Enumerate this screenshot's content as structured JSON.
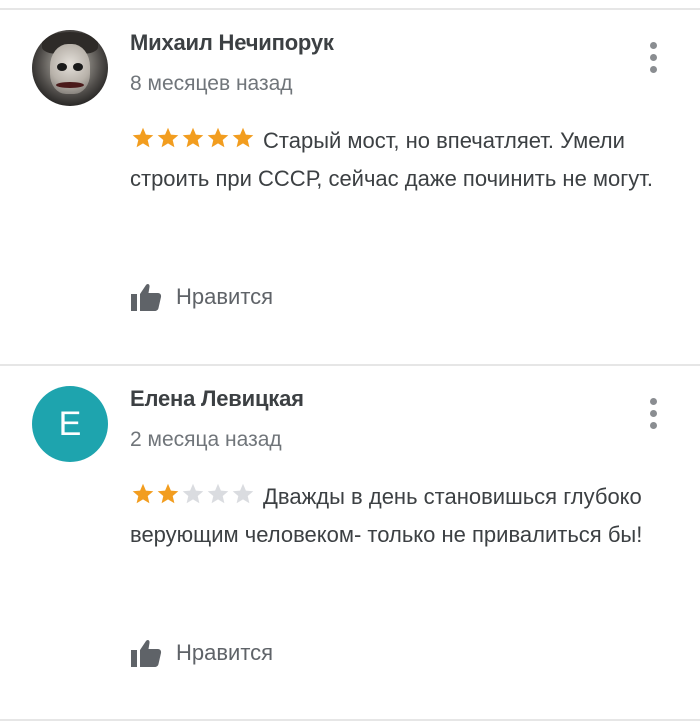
{
  "colors": {
    "star_filled": "#f29d1f",
    "star_empty": "#dadce0",
    "avatar_letter_bg": "#1ea4ae",
    "text": "#3c4043",
    "muted": "#70757a"
  },
  "reviews": [
    {
      "author": "Михаил Нечипорук",
      "date": "8 месяцев назад",
      "rating": 5,
      "max_rating": 5,
      "text": "Старый мост, но впечатляет. Умели строить при СССР, сейчас даже починить не могут.",
      "like_label": "Нравится",
      "avatar": {
        "type": "photo"
      },
      "menu_icon": "more-vert-icon"
    },
    {
      "author": "Елена Левицкая",
      "date": "2 месяца назад",
      "rating": 2,
      "max_rating": 5,
      "text": "Дважды в день становишься глубоко верующим человеком- только не привалиться бы!",
      "like_label": "Нравится",
      "avatar": {
        "type": "letter",
        "letter": "E"
      },
      "menu_icon": "more-vert-icon"
    }
  ]
}
